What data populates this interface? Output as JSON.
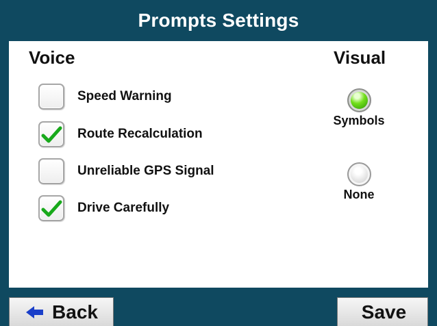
{
  "header": {
    "title": "Prompts Settings"
  },
  "voice": {
    "title": "Voice",
    "options": [
      {
        "label": "Speed Warning",
        "checked": false
      },
      {
        "label": "Route Recalculation",
        "checked": true
      },
      {
        "label": "Unreliable GPS Signal",
        "checked": false
      },
      {
        "label": "Drive Carefully",
        "checked": true
      }
    ]
  },
  "visual": {
    "title": "Visual",
    "options": [
      {
        "label": "Symbols",
        "selected": true
      },
      {
        "label": "None",
        "selected": false
      }
    ]
  },
  "footer": {
    "back_label": "Back",
    "save_label": "Save"
  },
  "icons": {
    "checkmark": "checkmark-icon",
    "back": "left-arrow-icon"
  },
  "colors": {
    "background": "#0f4960",
    "selected_radio": "#58d410",
    "checkmark": "#18a91b"
  }
}
